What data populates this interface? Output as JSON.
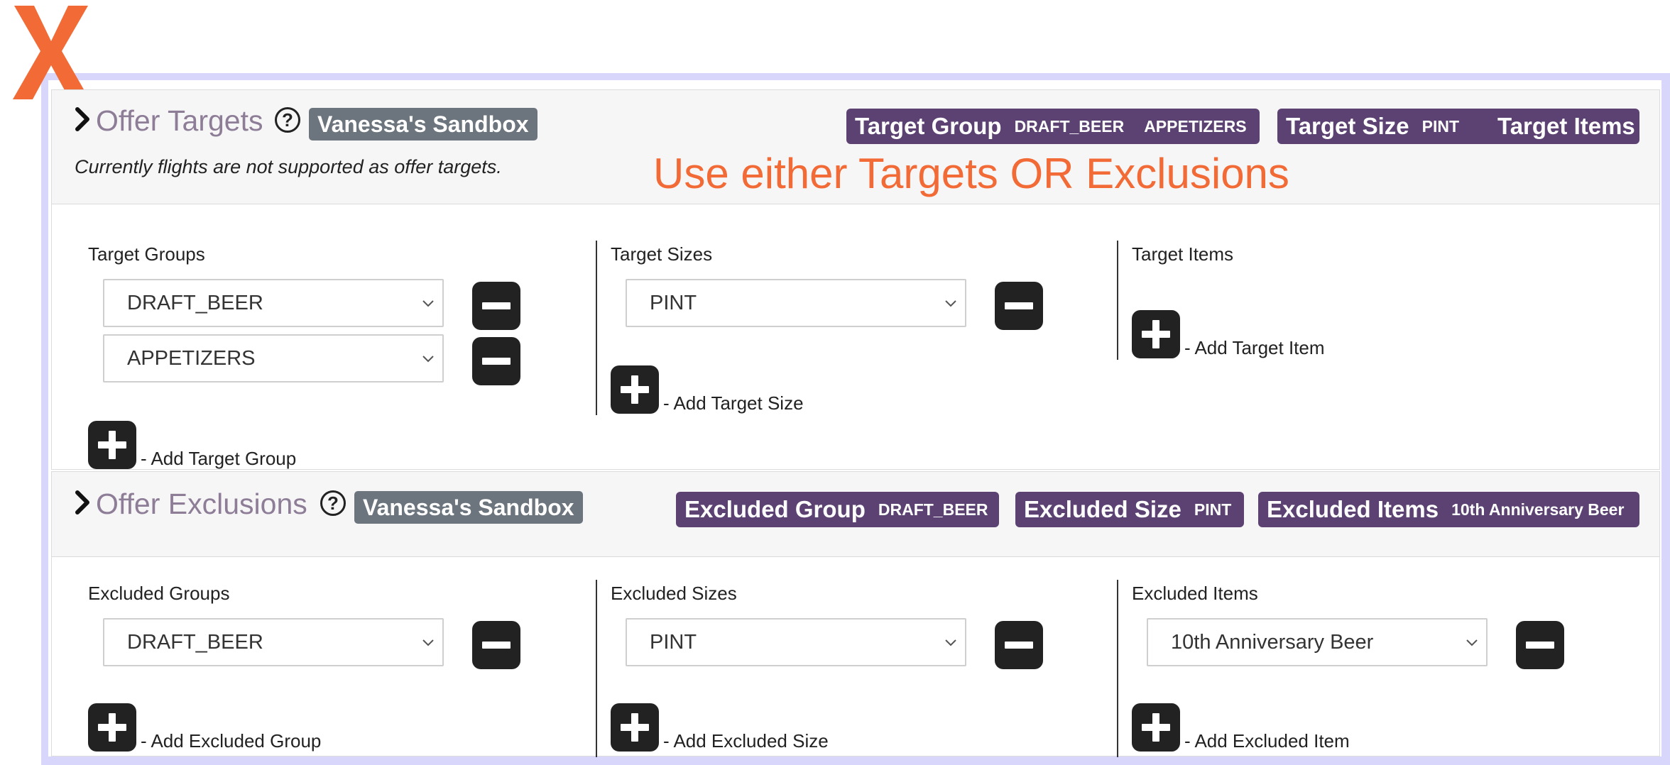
{
  "overlay": {
    "x_mark_color": "#f26a36",
    "hint": "Use either Targets OR Exclusions"
  },
  "colors": {
    "pill_bg": "#5c4272",
    "sandbox_bg": "#6c757d",
    "title": "#8e7d97",
    "frame": "#d8d6fb"
  },
  "targets": {
    "title": "Offer Targets",
    "sandbox": "Vanessa's Sandbox",
    "note": "Currently flights are not supported as offer targets.",
    "pills": {
      "group_label": "Target Group",
      "group_v1": "DRAFT_BEER",
      "group_v2": "APPETIZERS",
      "size_label": "Target Size",
      "size_v1": "PINT",
      "items_label": "Target Items"
    },
    "groups": {
      "label": "Target Groups",
      "values": [
        "DRAFT_BEER",
        "APPETIZERS"
      ],
      "add": "- Add Target Group"
    },
    "sizes": {
      "label": "Target Sizes",
      "values": [
        "PINT"
      ],
      "add": "- Add Target Size"
    },
    "items": {
      "label": "Target Items",
      "add": "- Add Target Item"
    }
  },
  "exclusions": {
    "title": "Offer Exclusions",
    "sandbox": "Vanessa's Sandbox",
    "pills": {
      "group_label": "Excluded Group",
      "group_v1": "DRAFT_BEER",
      "size_label": "Excluded Size",
      "size_v1": "PINT",
      "items_label": "Excluded Items",
      "items_v1": "10th Anniversary Beer"
    },
    "groups": {
      "label": "Excluded Groups",
      "values": [
        "DRAFT_BEER"
      ],
      "add": "- Add Excluded Group"
    },
    "sizes": {
      "label": "Excluded Sizes",
      "values": [
        "PINT"
      ],
      "add": "- Add Excluded Size"
    },
    "items": {
      "label": "Excluded Items",
      "values": [
        "10th Anniversary Beer"
      ],
      "add": "- Add Excluded Item"
    }
  },
  "icons": [
    "x-mark-icon",
    "chevron-right-icon",
    "help-icon",
    "chevron-down-icon",
    "minus-icon",
    "plus-icon"
  ]
}
